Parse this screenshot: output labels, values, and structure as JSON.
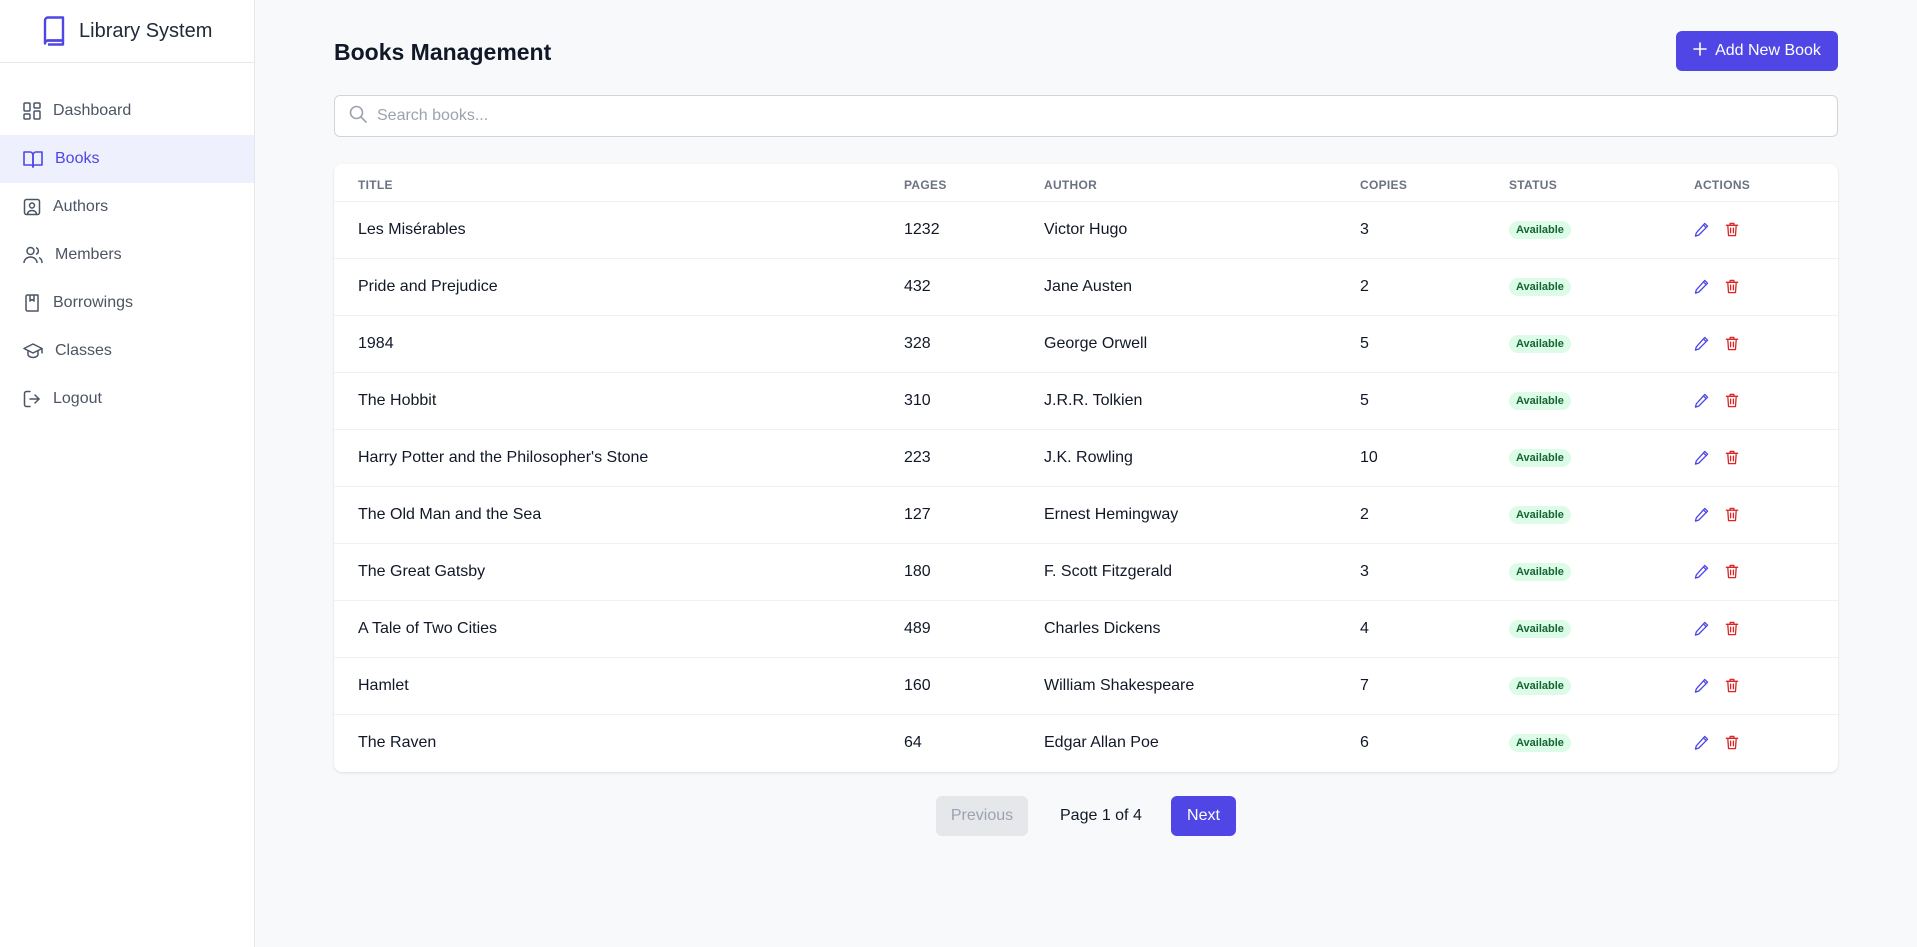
{
  "app": {
    "title": "Library System"
  },
  "sidebar": {
    "items": [
      {
        "label": "Dashboard",
        "icon": "dashboard-icon",
        "active": false
      },
      {
        "label": "Books",
        "icon": "book-open-icon",
        "active": true
      },
      {
        "label": "Authors",
        "icon": "contact-icon",
        "active": false
      },
      {
        "label": "Members",
        "icon": "users-icon",
        "active": false
      },
      {
        "label": "Borrowings",
        "icon": "bookmark-book-icon",
        "active": false
      },
      {
        "label": "Classes",
        "icon": "graduation-cap-icon",
        "active": false
      },
      {
        "label": "Logout",
        "icon": "logout-icon",
        "active": false
      }
    ]
  },
  "header": {
    "title": "Books Management",
    "add_label": "Add New Book"
  },
  "search": {
    "placeholder": "Search books...",
    "value": ""
  },
  "table": {
    "columns": [
      "Title",
      "Pages",
      "Author",
      "Copies",
      "Status",
      "Actions"
    ],
    "rows": [
      {
        "title": "Les Misérables",
        "pages": "1232",
        "author": "Victor Hugo",
        "copies": "3",
        "status": "Available"
      },
      {
        "title": "Pride and Prejudice",
        "pages": "432",
        "author": "Jane Austen",
        "copies": "2",
        "status": "Available"
      },
      {
        "title": "1984",
        "pages": "328",
        "author": "George Orwell",
        "copies": "5",
        "status": "Available"
      },
      {
        "title": "The Hobbit",
        "pages": "310",
        "author": "J.R.R. Tolkien",
        "copies": "5",
        "status": "Available"
      },
      {
        "title": "Harry Potter and the Philosopher's Stone",
        "pages": "223",
        "author": "J.K. Rowling",
        "copies": "10",
        "status": "Available"
      },
      {
        "title": "The Old Man and the Sea",
        "pages": "127",
        "author": "Ernest Hemingway",
        "copies": "2",
        "status": "Available"
      },
      {
        "title": "The Great Gatsby",
        "pages": "180",
        "author": "F. Scott Fitzgerald",
        "copies": "3",
        "status": "Available"
      },
      {
        "title": "A Tale of Two Cities",
        "pages": "489",
        "author": "Charles Dickens",
        "copies": "4",
        "status": "Available"
      },
      {
        "title": "Hamlet",
        "pages": "160",
        "author": "William Shakespeare",
        "copies": "7",
        "status": "Available"
      },
      {
        "title": "The Raven",
        "pages": "64",
        "author": "Edgar Allan Poe",
        "copies": "6",
        "status": "Available"
      }
    ]
  },
  "pagination": {
    "previous_label": "Previous",
    "page_info": "Page 1 of 4",
    "next_label": "Next"
  },
  "colors": {
    "accent": "#4f46e5",
    "danger": "#dc2626",
    "success_bg": "#dcfce7",
    "success_text": "#166534"
  }
}
